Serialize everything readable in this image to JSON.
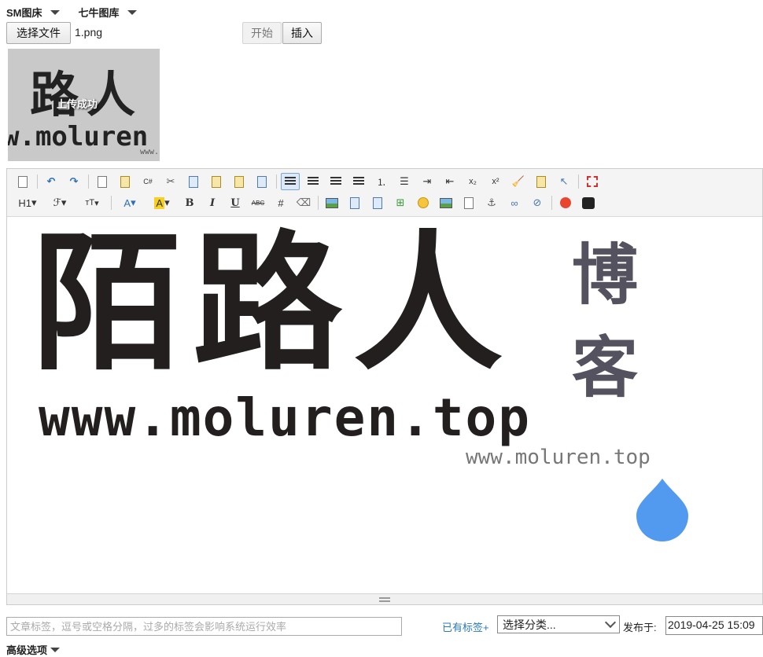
{
  "hosts": {
    "sm": "SM图床",
    "qiniu": "七牛图库"
  },
  "upload": {
    "choose_label": "选择文件",
    "file_name": "1.png",
    "start_label": "开始",
    "insert_label": "插入",
    "status": "上传成功"
  },
  "thumbnail": {
    "logo_text": "路人",
    "url_text": "w.moluren",
    "url_small": "www."
  },
  "toolbar": {
    "row1": [
      "source-icon",
      "undo-icon",
      "redo-icon",
      "preview-icon",
      "template-icon",
      "code-icon",
      "cut-icon",
      "copy-icon",
      "paste-icon",
      "paste-text-icon",
      "paste-word-icon",
      "align-left-icon",
      "align-center-icon",
      "align-right-icon",
      "align-justify-icon",
      "ordered-list-icon",
      "unordered-list-icon",
      "indent-icon",
      "outdent-icon",
      "subscript-icon",
      "superscript-icon",
      "clear-format-icon",
      "select-all-icon",
      "pointer-icon",
      "fullscreen-icon"
    ],
    "row2_labels": {
      "heading": "H1",
      "font": "ℱ",
      "size": "тT",
      "color": "A",
      "bg": "A",
      "bold": "B",
      "italic": "I",
      "underline": "U",
      "strike": "ABC",
      "grid": "#"
    }
  },
  "content": {
    "logo": "陌路人",
    "side": "博客",
    "url": "www.moluren.top",
    "url_small": "www.moluren.top"
  },
  "footer": {
    "tags_placeholder": "文章标签，逗号或空格分隔，过多的标签会影响系统运行效率",
    "existing_tags": "已有标签+",
    "category": "选择分类...",
    "publish_label": "发布于:",
    "publish_time": "2019-04-25 15:09",
    "advanced": "高级选项"
  },
  "colors": {
    "text": "#231f1f",
    "side_text": "#55525f",
    "drop": "#519af0",
    "link": "#2a7ab8"
  }
}
